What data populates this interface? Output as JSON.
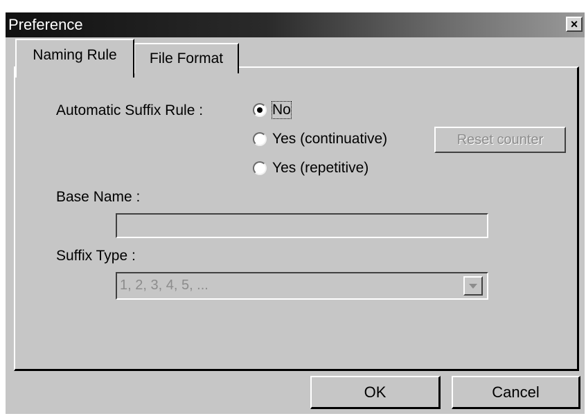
{
  "window": {
    "title": "Preference",
    "close_label": "×"
  },
  "tabs": [
    {
      "label": "Naming Rule",
      "active": true
    },
    {
      "label": "File Format",
      "active": false
    }
  ],
  "naming_rule": {
    "suffix_rule_label": "Automatic Suffix Rule :",
    "suffix_options": [
      {
        "label": "No",
        "checked": true
      },
      {
        "label": "Yes (continuative)",
        "checked": false
      },
      {
        "label": "Yes (repetitive)",
        "checked": false
      }
    ],
    "reset_counter_label": "Reset counter",
    "base_name_label": "Base Name :",
    "base_name_value": "",
    "suffix_type_label": "Suffix Type :",
    "suffix_type_value": "1, 2, 3, 4, 5, ..."
  },
  "buttons": {
    "ok_label": "OK",
    "cancel_label": "Cancel"
  },
  "icons": {
    "close": "close-icon",
    "dropdown": "chevron-down-icon"
  }
}
